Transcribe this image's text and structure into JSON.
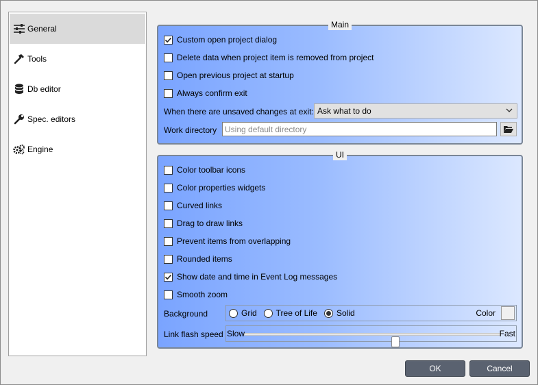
{
  "sidebar": {
    "items": [
      {
        "label": "General",
        "icon": "sliders-icon",
        "selected": true
      },
      {
        "label": "Tools",
        "icon": "hammer-icon",
        "selected": false
      },
      {
        "label": "Db editor",
        "icon": "database-icon",
        "selected": false
      },
      {
        "label": "Spec. editors",
        "icon": "wrench-icon",
        "selected": false
      },
      {
        "label": "Engine",
        "icon": "cogs-icon",
        "selected": false
      }
    ]
  },
  "main_group": {
    "title": "Main",
    "checkboxes": [
      {
        "label": "Custom open project dialog",
        "checked": true
      },
      {
        "label": "Delete data when project item is removed from project",
        "checked": false
      },
      {
        "label": "Open previous project at startup",
        "checked": false
      },
      {
        "label": "Always confirm exit",
        "checked": false
      }
    ],
    "unsaved_label": "When there are unsaved changes at exit:",
    "unsaved_value": "Ask what to do",
    "work_dir_label": "Work directory",
    "work_dir_value": "",
    "work_dir_placeholder": "Using default directory"
  },
  "ui_group": {
    "title": "UI",
    "checkboxes": [
      {
        "label": "Color toolbar icons",
        "checked": false
      },
      {
        "label": "Color properties widgets",
        "checked": false
      },
      {
        "label": "Curved links",
        "checked": false
      },
      {
        "label": "Drag to draw links",
        "checked": false
      },
      {
        "label": "Prevent items from overlapping",
        "checked": false
      },
      {
        "label": "Rounded items",
        "checked": false
      },
      {
        "label": "Show date and time in Event Log messages",
        "checked": true
      },
      {
        "label": "Smooth zoom",
        "checked": false
      }
    ],
    "background_label": "Background",
    "background_options": [
      {
        "label": "Grid",
        "selected": false
      },
      {
        "label": "Tree of Life",
        "selected": false
      },
      {
        "label": "Solid",
        "selected": true
      }
    ],
    "color_label": "Color",
    "link_flash_label": "Link flash speed",
    "slow_label": "Slow",
    "fast_label": "Fast",
    "link_flash_value_fraction": 0.59
  },
  "buttons": {
    "ok": "OK",
    "cancel": "Cancel"
  },
  "colors": {
    "group_gradient_start": "#7aa4ff",
    "group_gradient_end": "#dce8ff",
    "button_bg": "#5a6270",
    "selected_item": "#dadada"
  }
}
